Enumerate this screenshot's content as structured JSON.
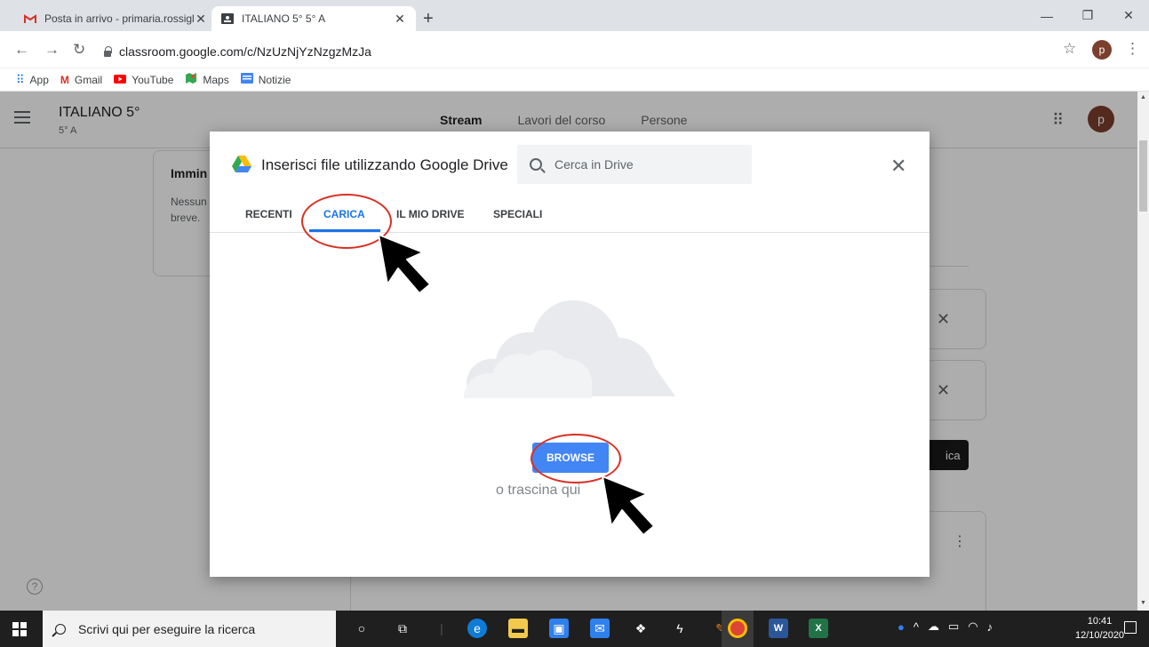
{
  "browser": {
    "tabs": [
      {
        "title": "Posta in arrivo - primaria.rossiglio",
        "icon": "gmail-icon"
      },
      {
        "title": "ITALIANO 5° 5° A",
        "icon": "classroom-icon"
      }
    ],
    "url": "classroom.google.com/c/NzUzNjYzNzgzMzJa",
    "profile_initial": "p",
    "bookmarks": [
      {
        "label": "App",
        "icon": "apps-grid-icon"
      },
      {
        "label": "Gmail",
        "icon": "gmail-icon"
      },
      {
        "label": "YouTube",
        "icon": "youtube-icon"
      },
      {
        "label": "Maps",
        "icon": "maps-icon"
      },
      {
        "label": "Notizie",
        "icon": "news-icon"
      }
    ]
  },
  "classroom": {
    "class_name": "ITALIANO 5°",
    "section": "5° A",
    "nav_tabs": [
      "Stream",
      "Lavori del corso",
      "Persone"
    ],
    "avatar_initial": "p",
    "card_title": "Immin",
    "card_text": "Nessun a breve.",
    "dark_button_label": "ica"
  },
  "picker": {
    "title": "Inserisci file utilizzando Google Drive",
    "search_placeholder": "Cerca in Drive",
    "tabs": [
      "RECENTI",
      "CARICA",
      "IL MIO DRIVE",
      "SPECIALI"
    ],
    "selected_tab": "CARICA",
    "browse_label": "BROWSE",
    "drop_text": "o trascina qui",
    "accent_color": "#1a73e8",
    "button_color": "#4285f4"
  },
  "taskbar": {
    "search_placeholder": "Scrivi qui per eseguire la ricerca",
    "time": "10:41",
    "date": "12/10/2020"
  }
}
